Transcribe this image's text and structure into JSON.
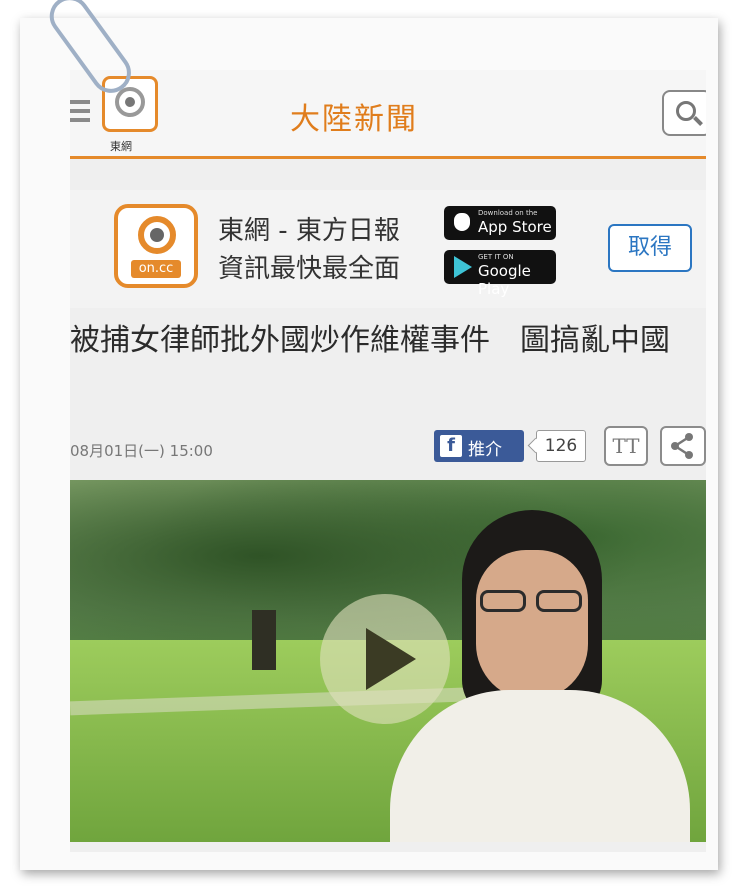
{
  "header": {
    "logo_label": "東網",
    "section_title": "大陸新聞"
  },
  "app_banner": {
    "line1": "東網 - 東方日報",
    "line2": "資訊最快最全面",
    "logo_text": "on.cc",
    "appstore_small": "Download on the",
    "appstore_big": "App Store",
    "googleplay_small": "GET IT ON",
    "googleplay_big": "Google Play",
    "get_label": "取得"
  },
  "article": {
    "headline": "被捕女律師批外國炒作維權事件　圖搞亂中國",
    "date": "08月01日(一) 15:00",
    "like_label": "推介",
    "like_count": "126",
    "text_size_label": "TT"
  },
  "colors": {
    "accent_orange": "#e58a2b",
    "link_blue": "#2b76c2",
    "facebook_blue": "#3b5a98"
  },
  "icons": [
    "menu-icon",
    "search-icon",
    "apple-icon",
    "google-play-icon",
    "facebook-icon",
    "text-size-icon",
    "share-icon",
    "play-icon",
    "paperclip-icon"
  ]
}
